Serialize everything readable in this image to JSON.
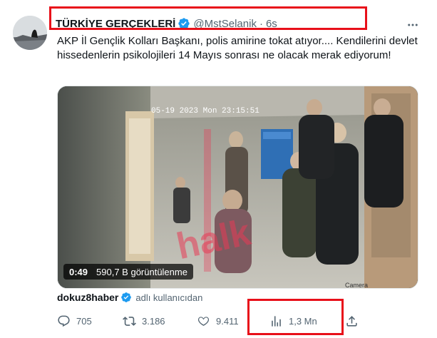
{
  "tweet": {
    "display_name": "TÜRKİYE GERÇEKLERİ",
    "handle": "@MstSelanik",
    "separator": "·",
    "time": "6s",
    "text": "AKP İl Gençlik Kolları Başkanı, polis amirine tokat atıyor.... Kendilerini devlet hissedenlerin psikolojileri 14 Mayıs sonrası ne olacak merak ediyorum!",
    "verified_color": "#1d9bf0",
    "highlight_color": "#e8101a"
  },
  "media": {
    "duration": "0:49",
    "views": "590,7 B görüntülenme",
    "cctv_timestamp": "05-19 2023 Mon 23:15:51",
    "watermark": "halk",
    "sign_text": "Camera"
  },
  "source": {
    "name": "dokuz8haber",
    "note": "adlı kullanıcıdan"
  },
  "actions": {
    "reply_count": "705",
    "retweet_count": "3.186",
    "like_count": "9.411",
    "views_count": "1,3 Mn"
  }
}
